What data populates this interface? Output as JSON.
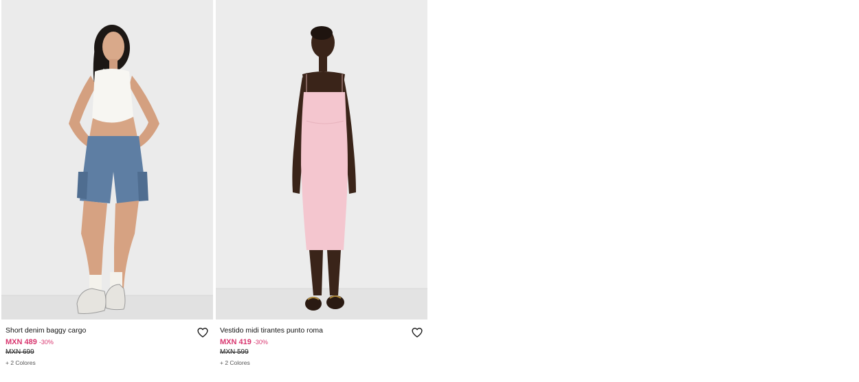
{
  "products": [
    {
      "name": "Short denim baggy cargo",
      "price": "MXN 489",
      "discount": "-30%",
      "old_price": "MXN 699",
      "colors": "+ 2 Colores",
      "image_icon": "model-photo-denim-shorts",
      "favorite_icon": "heart-outline-icon",
      "accent_color": "#d8356e"
    },
    {
      "name": "Vestido midi tirantes punto roma",
      "price": "MXN 419",
      "discount": "-30%",
      "old_price": "MXN 599",
      "colors": "+ 2 Colores",
      "image_icon": "model-photo-pink-dress",
      "favorite_icon": "heart-outline-icon",
      "accent_color": "#d8356e"
    }
  ]
}
